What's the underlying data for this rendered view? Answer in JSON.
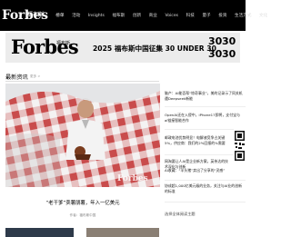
{
  "topnav": {
    "logo": "Forbes",
    "logo_cn": "福布斯",
    "items": [
      "榜单",
      "活动",
      "Insights",
      "福布斯",
      "创新",
      "商业",
      "Voices",
      "科技",
      "量子",
      "投资",
      "生活方式",
      "文化"
    ]
  },
  "banner": {
    "logo": "Forbes",
    "logo_cn": "福布斯",
    "text": "2025 福布斯中国征集 30 UNDER 30",
    "mark": [
      "30",
      "30",
      "30",
      "30"
    ]
  },
  "section": {
    "title": "最新资讯",
    "more": "更多 >"
  },
  "hero": {
    "watermark": "Forbes",
    "caption": "“老干爹”卖薯朋薯，年入一亿美元",
    "author": "作者：福布斯中国"
  },
  "sidebar": {
    "items": [
      "脑产：AI能否帮“惊奇事业”，美的记录示了同关机遇Deepseek新能",
      "OpenAI还在入侵中，iPhone17即将，支付宝与ai链接智能合作",
      "邮政电池优势明显！电解液竞争占关键5%，供应商：我们的2%回报的%需要",
      "网淘要让人AI是企业新方案，英伟达的技术深化与创新",
      "AI收藏：“半头猪”卖出了分享的“灵感”",
      "协成超1,000亿美元级的业务，关注与AI业的创新的标准",
      "自然安全科技金的的领域影响深远"
    ],
    "subscribe": "选择全体阅读主题"
  },
  "colors": {
    "nav_bg": "#000000",
    "banner_bg": "#ececec",
    "accent": "#000000"
  }
}
